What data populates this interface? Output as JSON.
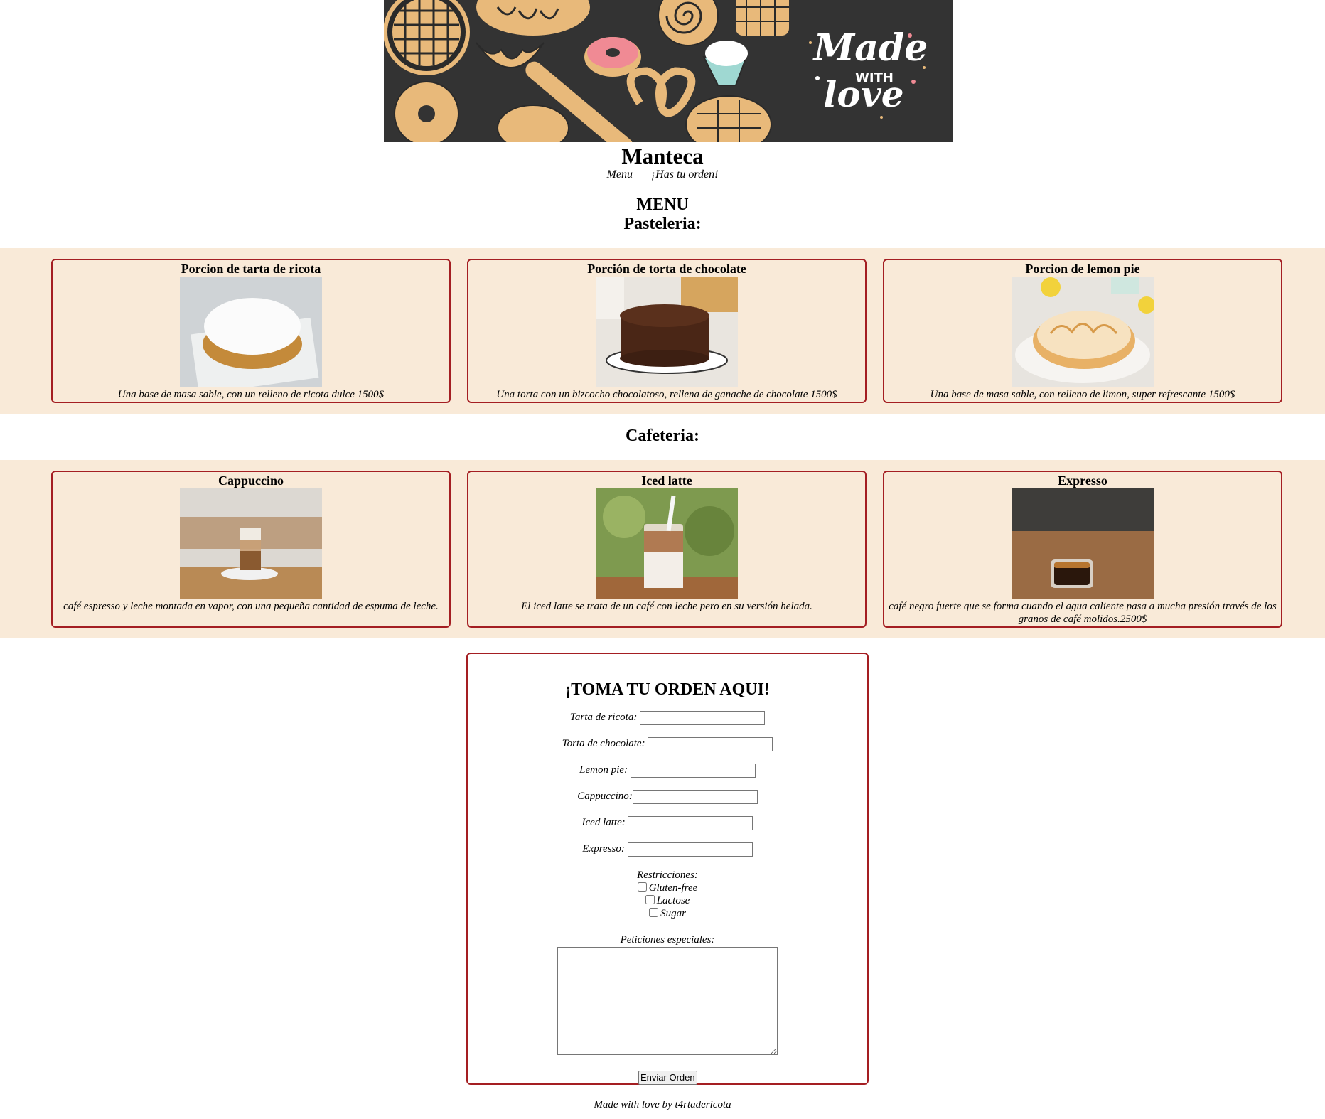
{
  "banner": {
    "logo_text_made": "Made",
    "logo_text_with": "WITH",
    "logo_text_love": "love"
  },
  "header": {
    "title": "Manteca",
    "nav": [
      "Menu",
      "¡Has tu orden!"
    ]
  },
  "menu": {
    "title": "MENU",
    "pasteleria": {
      "title": "Pasteleria:",
      "items": [
        {
          "name": "Porcion de tarta de ricota",
          "desc": "Una base de masa sable, con un relleno de ricota dulce 1500$"
        },
        {
          "name": "Porción de torta de chocolate",
          "desc": "Una torta con un bizcocho chocolatoso, rellena de ganache de chocolate 1500$"
        },
        {
          "name": "Porcion de lemon pie",
          "desc": "Una base de masa sable, con relleno de limon, super refrescante 1500$"
        }
      ]
    },
    "cafeteria": {
      "title": "Cafeteria:",
      "items": [
        {
          "name": "Cappuccino",
          "desc": "café espresso y leche montada en vapor, con una pequeña cantidad de espuma de leche."
        },
        {
          "name": "Iced latte",
          "desc": "El iced latte se trata de un café con leche pero en su versión helada."
        },
        {
          "name": "Expresso",
          "desc": "café negro fuerte que se forma cuando el agua caliente pasa a mucha presión través de los granos de café molidos.2500$"
        }
      ]
    }
  },
  "order": {
    "title": "¡TOMA TU ORDEN AQUI!",
    "fields": [
      {
        "label": "Tarta de ricota:",
        "value": ""
      },
      {
        "label": "Torta de chocolate:",
        "value": ""
      },
      {
        "label": "Lemon pie:",
        "value": ""
      },
      {
        "label": "Cappuccino:",
        "value": ""
      },
      {
        "label": "Iced latte:",
        "value": ""
      },
      {
        "label": "Expresso:",
        "value": ""
      }
    ],
    "restrictions_label": "Restricciones:",
    "restrictions": [
      "Gluten-free",
      "Lactose",
      "Sugar"
    ],
    "special_label": "Peticiones especiales:",
    "submit": "Enviar Orden"
  },
  "footer": {
    "text": "Made with love by t4rtadericota"
  },
  "colors": {
    "card_border": "#a41e22",
    "band_bg": "#f9ead8",
    "banner_bg": "#333333",
    "pastry_gold": "#e8b97a"
  },
  "icons": [
    "pie-icon",
    "bread-icon",
    "croissant-icon",
    "donut-icon",
    "pretzel-icon",
    "cupcake-icon",
    "waffle-icon",
    "cinnamon-roll-icon",
    "baguette-icon",
    "bun-icon"
  ]
}
